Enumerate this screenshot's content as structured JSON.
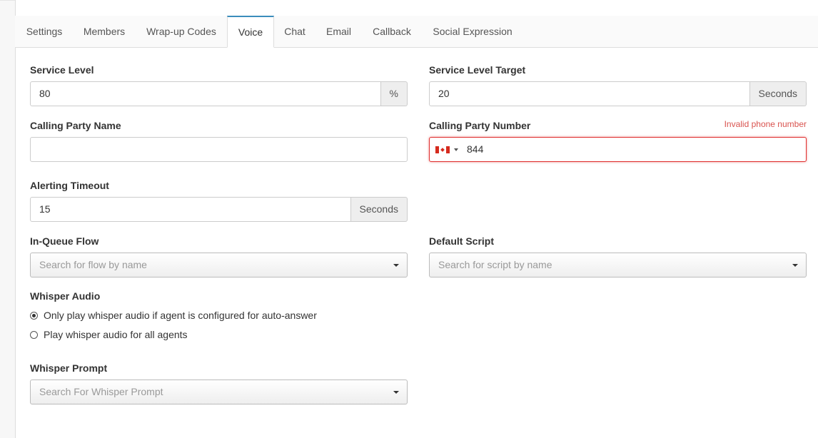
{
  "tabs": [
    {
      "label": "Settings"
    },
    {
      "label": "Members"
    },
    {
      "label": "Wrap-up Codes"
    },
    {
      "label": "Voice"
    },
    {
      "label": "Chat"
    },
    {
      "label": "Email"
    },
    {
      "label": "Callback"
    },
    {
      "label": "Social Expression"
    }
  ],
  "active_tab": "Voice",
  "service_level": {
    "label": "Service Level",
    "value": "80",
    "unit": "%"
  },
  "service_level_target": {
    "label": "Service Level Target",
    "value": "20",
    "unit": "Seconds"
  },
  "calling_party_name": {
    "label": "Calling Party Name",
    "value": ""
  },
  "calling_party_number": {
    "label": "Calling Party Number",
    "value": "844",
    "country_flag": "canada-flag-icon",
    "error": "Invalid phone number"
  },
  "alerting_timeout": {
    "label": "Alerting Timeout",
    "value": "15",
    "unit": "Seconds"
  },
  "in_queue_flow": {
    "label": "In-Queue Flow",
    "placeholder": "Search for flow by name"
  },
  "default_script": {
    "label": "Default Script",
    "placeholder": "Search for script by name"
  },
  "whisper_audio": {
    "label": "Whisper Audio",
    "options": [
      {
        "label": "Only play whisper audio if agent is configured for auto-answer",
        "checked": true
      },
      {
        "label": "Play whisper audio for all agents",
        "checked": false
      }
    ]
  },
  "whisper_prompt": {
    "label": "Whisper Prompt",
    "placeholder": "Search For Whisper Prompt"
  },
  "colors": {
    "accent": "#3c8dbc",
    "error": "#d9534f",
    "error_border": "#e0302f"
  }
}
